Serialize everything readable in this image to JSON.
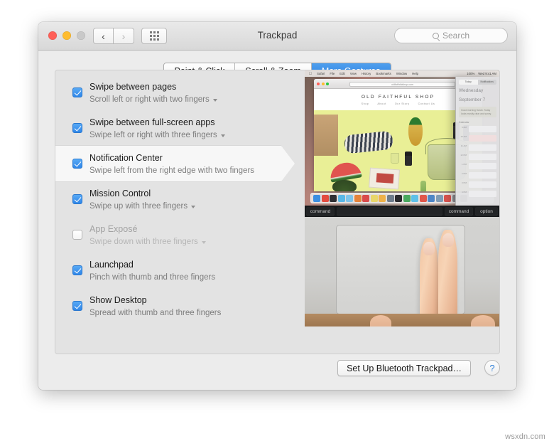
{
  "window": {
    "title": "Trackpad",
    "traffic_lights": [
      "close",
      "minimize",
      "zoom"
    ],
    "nav_back_icon": "chevron-left-icon",
    "nav_forward_icon": "chevron-right-icon",
    "grid_button_icon": "grid-apps-icon",
    "search": {
      "placeholder": "Search",
      "value": "",
      "icon": "search-icon"
    }
  },
  "tabs": [
    {
      "label": "Point & Click",
      "active": false
    },
    {
      "label": "Scroll & Zoom",
      "active": false
    },
    {
      "label": "More Gestures",
      "active": true
    }
  ],
  "gestures": [
    {
      "title": "Swipe between pages",
      "subtitle": "Scroll left or right with two fingers",
      "checked": true,
      "enabled": true,
      "has_dropdown": true,
      "selected": false
    },
    {
      "title": "Swipe between full-screen apps",
      "subtitle": "Swipe left or right with three fingers",
      "checked": true,
      "enabled": true,
      "has_dropdown": true,
      "selected": false
    },
    {
      "title": "Notification Center",
      "subtitle": "Swipe left from the right edge with two fingers",
      "checked": true,
      "enabled": true,
      "has_dropdown": false,
      "selected": true
    },
    {
      "title": "Mission Control",
      "subtitle": "Swipe up with three fingers",
      "checked": true,
      "enabled": true,
      "has_dropdown": true,
      "selected": false
    },
    {
      "title": "App Exposé",
      "subtitle": "Swipe down with three fingers",
      "checked": false,
      "enabled": false,
      "has_dropdown": true,
      "selected": false
    },
    {
      "title": "Launchpad",
      "subtitle": "Pinch with thumb and three fingers",
      "checked": true,
      "enabled": true,
      "has_dropdown": false,
      "selected": false
    },
    {
      "title": "Show Desktop",
      "subtitle": "Spread with thumb and three fingers",
      "checked": true,
      "enabled": true,
      "has_dropdown": false,
      "selected": false
    }
  ],
  "demo": {
    "menubar": {
      "apple": "",
      "items": [
        "Safari",
        "File",
        "Edit",
        "View",
        "History",
        "Bookmarks",
        "Window",
        "Help"
      ],
      "right_items": [
        "100%",
        "Wed 9:41 AM"
      ]
    },
    "safari": {
      "url": "oldfaithfulshop.com",
      "shop_name": "OLD FAITHFUL SHOP",
      "nav": [
        "Shop",
        "About",
        "Our Story",
        "Contact Us"
      ]
    },
    "notification_center": {
      "segments": [
        "Today",
        "Notifications"
      ],
      "selected_segment": "Today",
      "date_line_1": "Wednesday",
      "date_line_2": "September 7",
      "card_text": "Good morning Sarah. Today looks mostly clear and sunny.",
      "section_title": "Calendar",
      "events": [
        {
          "time": "9 AM",
          "red": false
        },
        {
          "time": "10 AM",
          "red": true
        },
        {
          "time": "11 AM",
          "red": false
        },
        {
          "time": "12 PM",
          "red": false
        },
        {
          "time": "1 PM",
          "red": false
        },
        {
          "time": "2 PM",
          "red": false
        },
        {
          "time": "3 PM",
          "red": false
        },
        {
          "time": "4 PM",
          "red": false
        }
      ]
    },
    "keyboard_keys": [
      "command",
      "",
      "command",
      "option"
    ]
  },
  "footer": {
    "setup_button": "Set Up Bluetooth Trackpad…",
    "help_button": "?"
  },
  "watermark": "wsxdn.com",
  "colors": {
    "accent": "#2a7fe0",
    "checkbox_on": "#2f86e8",
    "window_bg": "#ececec",
    "panel_bg": "#e3e3e3",
    "selected_row_bg": "#f7f7f7"
  }
}
